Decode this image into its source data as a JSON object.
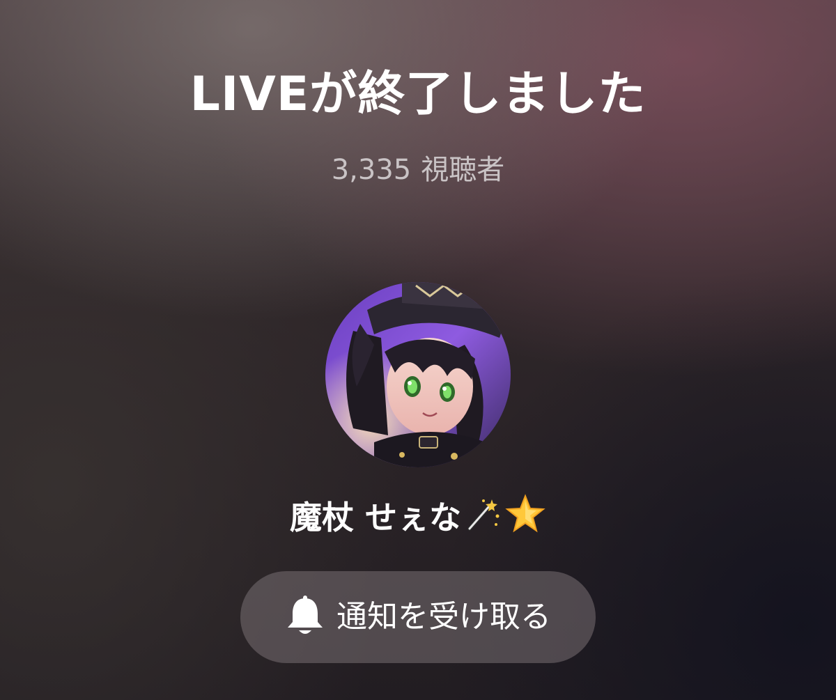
{
  "end_screen": {
    "title": "LIVEが終了しました",
    "viewer_count": "3,335",
    "viewer_label": "視聴者",
    "streamer": {
      "name": "魔杖 せぇな",
      "name_emojis": [
        "magic-wand-icon",
        "star-icon"
      ]
    },
    "notify_button": {
      "label": "通知を受け取る",
      "icon": "bell-icon"
    }
  },
  "colors": {
    "text_primary": "#ffffff",
    "text_secondary": "#c9c3c5",
    "button_bg": "rgba(120,112,114,0.55)"
  }
}
